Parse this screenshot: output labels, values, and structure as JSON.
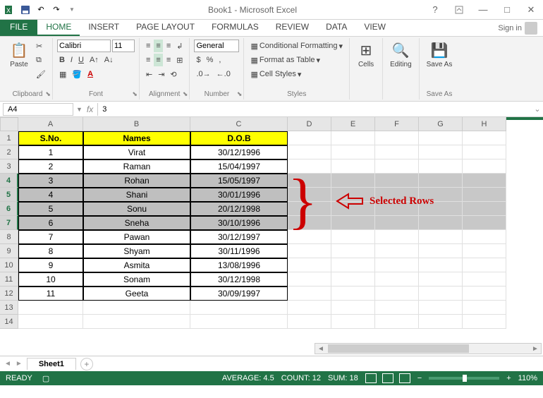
{
  "title": "Book1 - Microsoft Excel",
  "tabs": [
    "HOME",
    "INSERT",
    "PAGE LAYOUT",
    "FORMULAS",
    "REVIEW",
    "DATA",
    "VIEW"
  ],
  "active_tab": "HOME",
  "file_tab": "FILE",
  "signin": "Sign in",
  "ribbon": {
    "font_name": "Calibri",
    "font_size": "11",
    "number_format": "General",
    "groups": {
      "clipboard": "Clipboard",
      "font": "Font",
      "alignment": "Alignment",
      "number": "Number",
      "styles": "Styles",
      "cells": "Cells",
      "editing": "Editing",
      "saveas": "Save As"
    },
    "cond_fmt": "Conditional Formatting",
    "fmt_table": "Format as Table",
    "cell_styles": "Cell Styles",
    "paste": "Paste",
    "cells_btn": "Cells",
    "editing_btn": "Editing",
    "save_as": "Save As"
  },
  "namebox": "A4",
  "formula_value": "3",
  "columns": [
    "A",
    "B",
    "C",
    "D",
    "E",
    "F",
    "G",
    "H"
  ],
  "header_cells": [
    "S.No.",
    "Names",
    "D.O.B"
  ],
  "rows": [
    {
      "sno": "1",
      "name": "Virat",
      "dob": "30/12/1996"
    },
    {
      "sno": "2",
      "name": "Raman",
      "dob": "15/04/1997"
    },
    {
      "sno": "3",
      "name": "Rohan",
      "dob": "15/05/1997"
    },
    {
      "sno": "4",
      "name": "Shani",
      "dob": "30/01/1996"
    },
    {
      "sno": "5",
      "name": "Sonu",
      "dob": "20/12/1998"
    },
    {
      "sno": "6",
      "name": "Sneha",
      "dob": "30/10/1996"
    },
    {
      "sno": "7",
      "name": "Pawan",
      "dob": "30/12/1997"
    },
    {
      "sno": "8",
      "name": "Shyam",
      "dob": "30/11/1996"
    },
    {
      "sno": "9",
      "name": "Asmita",
      "dob": "13/08/1996"
    },
    {
      "sno": "10",
      "name": "Sonam",
      "dob": "30/12/1998"
    },
    {
      "sno": "11",
      "name": "Geeta",
      "dob": "30/09/1997"
    }
  ],
  "selected_rows": [
    4,
    5,
    6,
    7
  ],
  "annotation": "Selected Rows",
  "sheet_name": "Sheet1",
  "status": {
    "ready": "READY",
    "average_label": "AVERAGE:",
    "average": "4.5",
    "count_label": "COUNT:",
    "count": "12",
    "sum_label": "SUM:",
    "sum": "18",
    "zoom": "110%"
  }
}
